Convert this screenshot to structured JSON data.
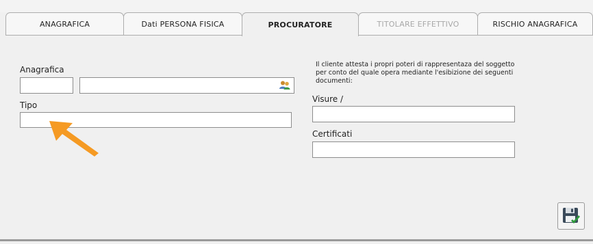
{
  "tabs": [
    {
      "label": "ANAGRAFICA",
      "state": "normal"
    },
    {
      "label": "Dati PERSONA FISICA",
      "state": "normal"
    },
    {
      "label": "PROCURATORE",
      "state": "active"
    },
    {
      "label": "TITOLARE EFFETTIVO",
      "state": "disabled"
    },
    {
      "label": "RISCHIO ANAGRAFICA",
      "state": "normal"
    }
  ],
  "left": {
    "anagrafica_label": "Anagrafica",
    "anagrafica_code_value": "",
    "anagrafica_name_value": "",
    "lookup_icon": "people-lookup-icon",
    "tipo_label": "Tipo",
    "tipo_value": ""
  },
  "right": {
    "note_line1": "Il cliente attesta i propri poteri di rappresentaza del soggetto",
    "note_line2": "per conto del quale opera mediante l'esibizione dei seguenti",
    "note_line3": "documenti:",
    "visure_label": "Visure /",
    "visure_value": "",
    "certificati_label": "Certificati",
    "certificati_value": ""
  },
  "save_icon": "save-floppy-check-icon",
  "annotation_icon": "orange-arrow-icon",
  "colors": {
    "accent_arrow": "#f59a23",
    "background": "#f0f0f0",
    "disabled_text": "#a8a8a8"
  }
}
